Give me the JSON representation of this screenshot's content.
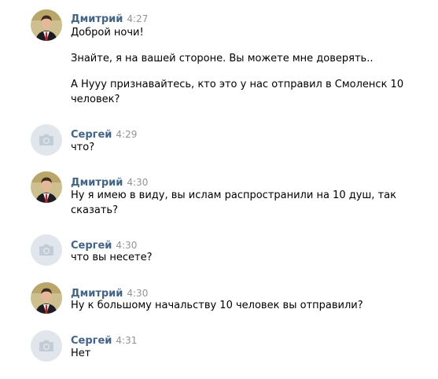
{
  "messages": [
    {
      "author": "Дмитрий",
      "time": "4:27",
      "avatar": "photo-avatar",
      "paragraphs": [
        "Доброй ночи!",
        "Знайте, я на вашей стороне. Вы можете мне доверять..",
        "А Нууу признавайтесь, кто это у нас отправил в Смоленск 10 человек?"
      ]
    },
    {
      "author": "Сергей",
      "time": "4:29",
      "avatar": "camera-icon",
      "paragraphs": [
        "что?"
      ]
    },
    {
      "author": "Дмитрий",
      "time": "4:30",
      "avatar": "photo-avatar",
      "paragraphs": [
        "Ну я имею в виду, вы ислам распространили на 10 душ, так сказать?"
      ]
    },
    {
      "author": "Сергей",
      "time": "4:30",
      "avatar": "camera-icon",
      "paragraphs": [
        "что вы несете?"
      ]
    },
    {
      "author": "Дмитрий",
      "time": "4:30",
      "avatar": "photo-avatar",
      "paragraphs": [
        "Ну к большому начальству 10 человек вы отправили?"
      ]
    },
    {
      "author": "Сергей",
      "time": "4:31",
      "avatar": "camera-icon",
      "paragraphs": [
        "Нет"
      ]
    }
  ],
  "colors": {
    "author": "#42648b",
    "time": "#939393",
    "placeholder_avatar_bg": "#e1e6ec",
    "placeholder_icon": "#c2ccd6"
  }
}
